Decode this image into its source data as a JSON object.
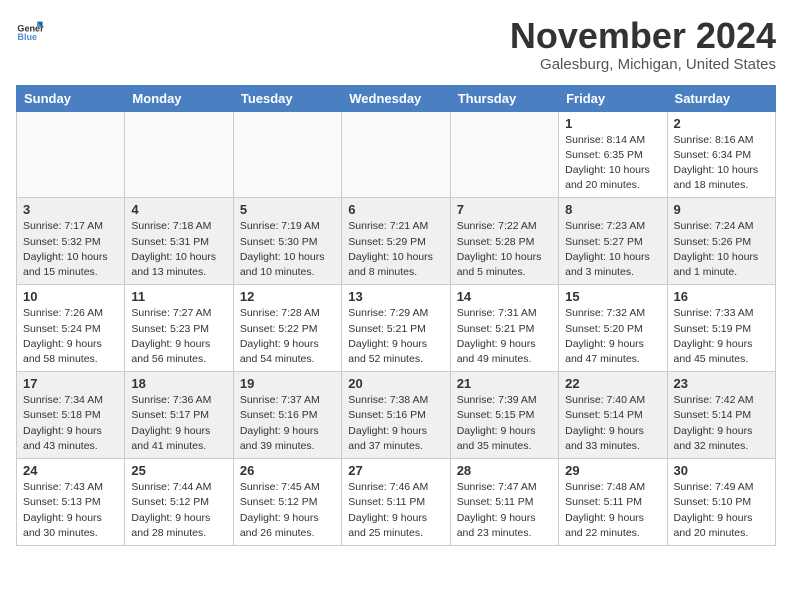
{
  "header": {
    "logo_general": "General",
    "logo_blue": "Blue",
    "month_title": "November 2024",
    "location": "Galesburg, Michigan, United States"
  },
  "days_of_week": [
    "Sunday",
    "Monday",
    "Tuesday",
    "Wednesday",
    "Thursday",
    "Friday",
    "Saturday"
  ],
  "weeks": [
    [
      {
        "day": "",
        "info": ""
      },
      {
        "day": "",
        "info": ""
      },
      {
        "day": "",
        "info": ""
      },
      {
        "day": "",
        "info": ""
      },
      {
        "day": "",
        "info": ""
      },
      {
        "day": "1",
        "info": "Sunrise: 8:14 AM\nSunset: 6:35 PM\nDaylight: 10 hours\nand 20 minutes."
      },
      {
        "day": "2",
        "info": "Sunrise: 8:16 AM\nSunset: 6:34 PM\nDaylight: 10 hours\nand 18 minutes."
      }
    ],
    [
      {
        "day": "3",
        "info": "Sunrise: 7:17 AM\nSunset: 5:32 PM\nDaylight: 10 hours\nand 15 minutes."
      },
      {
        "day": "4",
        "info": "Sunrise: 7:18 AM\nSunset: 5:31 PM\nDaylight: 10 hours\nand 13 minutes."
      },
      {
        "day": "5",
        "info": "Sunrise: 7:19 AM\nSunset: 5:30 PM\nDaylight: 10 hours\nand 10 minutes."
      },
      {
        "day": "6",
        "info": "Sunrise: 7:21 AM\nSunset: 5:29 PM\nDaylight: 10 hours\nand 8 minutes."
      },
      {
        "day": "7",
        "info": "Sunrise: 7:22 AM\nSunset: 5:28 PM\nDaylight: 10 hours\nand 5 minutes."
      },
      {
        "day": "8",
        "info": "Sunrise: 7:23 AM\nSunset: 5:27 PM\nDaylight: 10 hours\nand 3 minutes."
      },
      {
        "day": "9",
        "info": "Sunrise: 7:24 AM\nSunset: 5:26 PM\nDaylight: 10 hours\nand 1 minute."
      }
    ],
    [
      {
        "day": "10",
        "info": "Sunrise: 7:26 AM\nSunset: 5:24 PM\nDaylight: 9 hours\nand 58 minutes."
      },
      {
        "day": "11",
        "info": "Sunrise: 7:27 AM\nSunset: 5:23 PM\nDaylight: 9 hours\nand 56 minutes."
      },
      {
        "day": "12",
        "info": "Sunrise: 7:28 AM\nSunset: 5:22 PM\nDaylight: 9 hours\nand 54 minutes."
      },
      {
        "day": "13",
        "info": "Sunrise: 7:29 AM\nSunset: 5:21 PM\nDaylight: 9 hours\nand 52 minutes."
      },
      {
        "day": "14",
        "info": "Sunrise: 7:31 AM\nSunset: 5:21 PM\nDaylight: 9 hours\nand 49 minutes."
      },
      {
        "day": "15",
        "info": "Sunrise: 7:32 AM\nSunset: 5:20 PM\nDaylight: 9 hours\nand 47 minutes."
      },
      {
        "day": "16",
        "info": "Sunrise: 7:33 AM\nSunset: 5:19 PM\nDaylight: 9 hours\nand 45 minutes."
      }
    ],
    [
      {
        "day": "17",
        "info": "Sunrise: 7:34 AM\nSunset: 5:18 PM\nDaylight: 9 hours\nand 43 minutes."
      },
      {
        "day": "18",
        "info": "Sunrise: 7:36 AM\nSunset: 5:17 PM\nDaylight: 9 hours\nand 41 minutes."
      },
      {
        "day": "19",
        "info": "Sunrise: 7:37 AM\nSunset: 5:16 PM\nDaylight: 9 hours\nand 39 minutes."
      },
      {
        "day": "20",
        "info": "Sunrise: 7:38 AM\nSunset: 5:16 PM\nDaylight: 9 hours\nand 37 minutes."
      },
      {
        "day": "21",
        "info": "Sunrise: 7:39 AM\nSunset: 5:15 PM\nDaylight: 9 hours\nand 35 minutes."
      },
      {
        "day": "22",
        "info": "Sunrise: 7:40 AM\nSunset: 5:14 PM\nDaylight: 9 hours\nand 33 minutes."
      },
      {
        "day": "23",
        "info": "Sunrise: 7:42 AM\nSunset: 5:14 PM\nDaylight: 9 hours\nand 32 minutes."
      }
    ],
    [
      {
        "day": "24",
        "info": "Sunrise: 7:43 AM\nSunset: 5:13 PM\nDaylight: 9 hours\nand 30 minutes."
      },
      {
        "day": "25",
        "info": "Sunrise: 7:44 AM\nSunset: 5:12 PM\nDaylight: 9 hours\nand 28 minutes."
      },
      {
        "day": "26",
        "info": "Sunrise: 7:45 AM\nSunset: 5:12 PM\nDaylight: 9 hours\nand 26 minutes."
      },
      {
        "day": "27",
        "info": "Sunrise: 7:46 AM\nSunset: 5:11 PM\nDaylight: 9 hours\nand 25 minutes."
      },
      {
        "day": "28",
        "info": "Sunrise: 7:47 AM\nSunset: 5:11 PM\nDaylight: 9 hours\nand 23 minutes."
      },
      {
        "day": "29",
        "info": "Sunrise: 7:48 AM\nSunset: 5:11 PM\nDaylight: 9 hours\nand 22 minutes."
      },
      {
        "day": "30",
        "info": "Sunrise: 7:49 AM\nSunset: 5:10 PM\nDaylight: 9 hours\nand 20 minutes."
      }
    ]
  ]
}
